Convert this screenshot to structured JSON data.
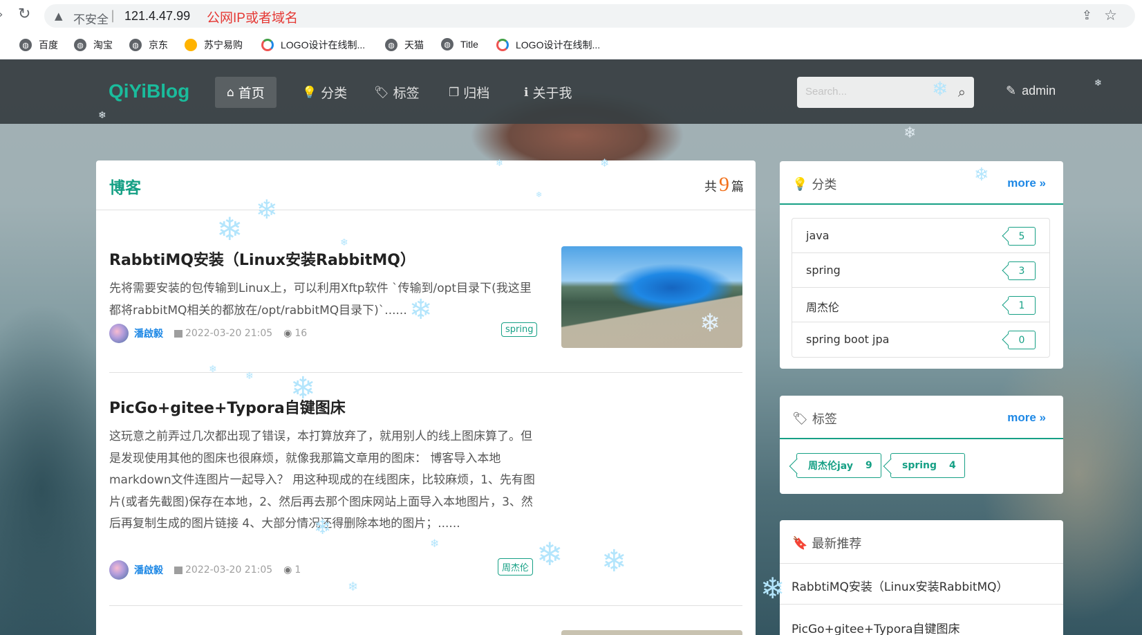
{
  "browser": {
    "insecure_label": "不安全",
    "url": "121.4.47.99",
    "url_note": "公网IP或者域名",
    "bookmarks": [
      "百度",
      "淘宝",
      "京东",
      "苏宁易购",
      "LOGO设计在线制...",
      "天猫",
      "Title",
      "LOGO设计在线制..."
    ]
  },
  "navbar": {
    "brand": "QiYiBlog",
    "items": [
      "首页",
      "分类",
      "标签",
      "归档",
      "关于我"
    ],
    "search_placeholder": "Search...",
    "admin": "admin"
  },
  "main": {
    "title": "博客",
    "count_prefix": "共",
    "count": "9",
    "count_suffix": "篇",
    "posts": [
      {
        "title": "RabbtiMQ安装（Linux安装RabbitMQ）",
        "excerpt": "先将需要安装的包传输到Linux上，可以利用Xftp软件 `传输到/opt目录下(我这里都将rabbitMQ相关的都放在/opt/rabbitMQ目录下)`......",
        "author": "潘啟毅",
        "date": "2022-03-20 21:05",
        "views": "16",
        "tag": "spring"
      },
      {
        "title": "PicGo+gitee+Typora自键图床",
        "excerpt": "这玩意之前弄过几次都出现了错误，本打算放弃了，就用别人的线上图床算了。但是发现使用其他的图床也很麻烦，就像我那篇文章用的图床： 博客导入本地markdown文件连图片一起导入？ 用这种现成的在线图床，比较麻烦，1、先有图片(或者先截图)保存在本地，2、然后再去那个图床网站上面导入本地图片，3、然后再复制生成的图片链接 4、大部分情况还得删除本地的图片；......",
        "author": "潘啟毅",
        "date": "2022-03-20 21:05",
        "views": "1",
        "tag": "周杰伦"
      }
    ]
  },
  "sidebar": {
    "categories": {
      "title": "分类",
      "more": "more",
      "items": [
        {
          "name": "java",
          "count": "5"
        },
        {
          "name": "spring",
          "count": "3"
        },
        {
          "name": "周杰伦",
          "count": "1"
        },
        {
          "name": "spring boot jpa",
          "count": "0"
        }
      ]
    },
    "tags": {
      "title": "标签",
      "more": "more",
      "items": [
        {
          "name": "周杰伦jay",
          "count": "9"
        },
        {
          "name": "spring",
          "count": "4"
        }
      ]
    },
    "recommend": {
      "title": "最新推荐",
      "items": [
        "RabbtiMQ安装（Linux安装RabbitMQ）",
        "PicGo+gitee+Typora自键图床"
      ]
    }
  },
  "colors": {
    "brand": "#1abc9c",
    "accent": "#16a085",
    "link": "#1e88e5",
    "count_highlight": "#f2711c",
    "url_note": "#e53935"
  }
}
